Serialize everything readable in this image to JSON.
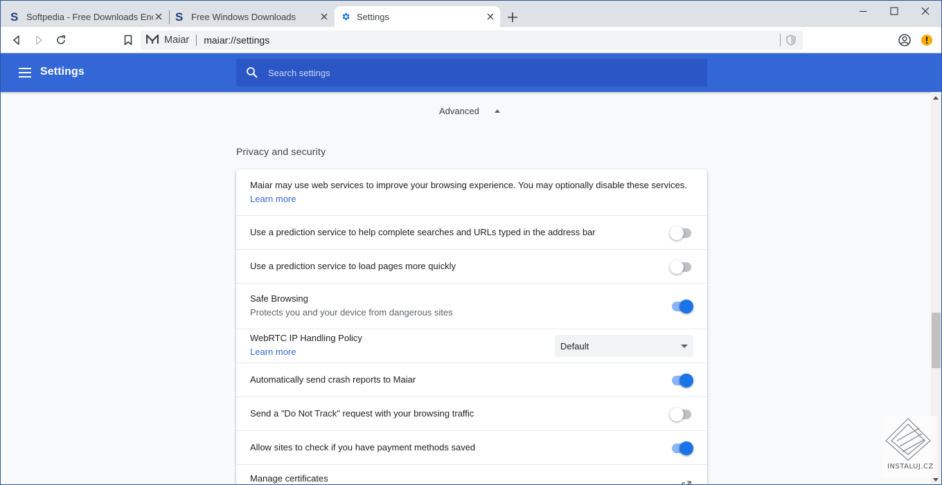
{
  "tabs": [
    {
      "title": "Softpedia - Free Downloads Encyclopedia",
      "icon": "softpedia-icon",
      "active": false
    },
    {
      "title": "Free Windows Downloads",
      "icon": "softpedia-icon",
      "active": false
    },
    {
      "title": "Settings",
      "icon": "gear-icon",
      "active": true
    }
  ],
  "toolbar": {
    "browser_name": "Maiar",
    "url": "maiar://settings"
  },
  "header": {
    "title": "Settings",
    "search_placeholder": "Search settings"
  },
  "advanced_label": "Advanced",
  "section": {
    "title": "Privacy and security",
    "intro": "Maiar may use web services to improve your browsing experience. You may optionally disable these services.",
    "intro_link": "Learn more",
    "rows": [
      {
        "label": "Use a prediction service to help complete searches and URLs typed in the address bar",
        "toggle": false
      },
      {
        "label": "Use a prediction service to load pages more quickly",
        "toggle": false
      },
      {
        "label": "Safe Browsing",
        "sublabel": "Protects you and your device from dangerous sites",
        "toggle": true
      },
      {
        "label": "WebRTC IP Handling Policy",
        "link": "Learn more",
        "dropdown_value": "Default"
      },
      {
        "label": "Automatically send crash reports to Maiar",
        "toggle": true
      },
      {
        "label": "Send a \"Do Not Track\" request with your browsing traffic",
        "toggle": false
      },
      {
        "label": "Allow sites to check if you have payment methods saved",
        "toggle": true
      },
      {
        "label": "Manage certificates"
      }
    ]
  },
  "watermark": {
    "text": "INSTALUJ.CZ"
  },
  "colors": {
    "header_blue": "#3367d6",
    "search_blue": "#2a56c6",
    "toggle_on": "#1a73e8",
    "alert": "#f9ab00"
  }
}
